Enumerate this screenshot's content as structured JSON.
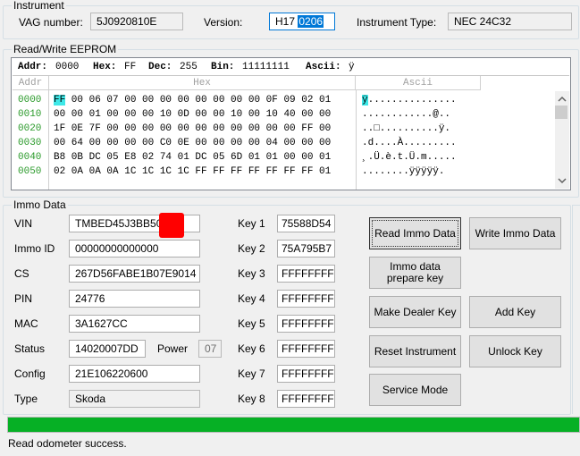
{
  "instrument": {
    "title": "Instrument",
    "vag_label": "VAG number:",
    "vag_value": "5J0920810E",
    "version_label": "Version:",
    "version_prefix": "H17",
    "version_selected": "0206",
    "type_label": "Instrument Type:",
    "type_value": "NEC 24C32"
  },
  "eeprom": {
    "title": "Read/Write EEPROM",
    "status": {
      "addr_label": "Addr:",
      "addr_value": "0000",
      "hex_label": "Hex:",
      "hex_value": "FF",
      "dec_label": "Dec:",
      "dec_value": "255",
      "bin_label": "Bin:",
      "bin_value": "11111111",
      "ascii_label": "Ascii:",
      "ascii_value": "ÿ"
    },
    "col_addr": "Addr",
    "col_hex": "Hex",
    "col_ascii": "Ascii",
    "rows": [
      {
        "addr": "0000",
        "hex_first": "FF",
        "hex_rest": " 00 06 07 00 00 00 00 00 00 00 00 0F 09 02 01",
        "ascii_first": "ÿ",
        "ascii_rest": "..............."
      },
      {
        "addr": "0010",
        "hex_first": "",
        "hex_rest": "00 00 01 00 00 00 10 0D 00 00 10 00 10 40 00 00",
        "ascii_first": "",
        "ascii_rest": "............@.."
      },
      {
        "addr": "0020",
        "hex_first": "",
        "hex_rest": "1F 0E 7F 00 00 00 00 00 00 00 00 00 00 00 FF 00",
        "ascii_first": "",
        "ascii_rest": "..□..........ÿ."
      },
      {
        "addr": "0030",
        "hex_first": "",
        "hex_rest": "00 64 00 00 00 00 C0 0E 00 00 00 00 04 00 00 00",
        "ascii_first": "",
        "ascii_rest": ".d....À........."
      },
      {
        "addr": "0040",
        "hex_first": "",
        "hex_rest": "B8 0B DC 05 E8 02 74 01 DC 05 6D 01 01 00 00 01",
        "ascii_first": "",
        "ascii_rest": "¸.Ü.è.t.Ü.m....."
      },
      {
        "addr": "0050",
        "hex_first": "",
        "hex_rest": "02 0A 0A 0A 1C 1C 1C 1C FF FF FF FF FF FF FF 01",
        "ascii_first": "",
        "ascii_rest": "........ÿÿÿÿÿ."
      }
    ]
  },
  "immo": {
    "title": "Immo Data",
    "vin_label": "VIN",
    "vin_value": "TMBED45J3BB50",
    "immo_id_label": "Immo ID",
    "immo_id_value": "00000000000000",
    "cs_label": "CS",
    "cs_value": "267D56FABE1B07E9014",
    "pin_label": "PIN",
    "pin_value": "24776",
    "mac_label": "MAC",
    "mac_value": "3A1627CC",
    "status_label": "Status",
    "status_value": "14020007DD",
    "power_label": "Power",
    "power_value": "07",
    "config_label": "Config",
    "config_value": "21E106220600",
    "type_label": "Type",
    "type_value": "Skoda",
    "keys": [
      {
        "label": "Key 1",
        "value": "75588D54"
      },
      {
        "label": "Key 2",
        "value": "75A795B7"
      },
      {
        "label": "Key 3",
        "value": "FFFFFFFF"
      },
      {
        "label": "Key 4",
        "value": "FFFFFFFF"
      },
      {
        "label": "Key 5",
        "value": "FFFFFFFF"
      },
      {
        "label": "Key 6",
        "value": "FFFFFFFF"
      },
      {
        "label": "Key 7",
        "value": "FFFFFFFF"
      },
      {
        "label": "Key 8",
        "value": "FFFFFFFF"
      }
    ]
  },
  "buttons": {
    "read_immo": "Read Immo Data",
    "write_immo": "Write Immo Data",
    "immo_prepare_1": "Immo data",
    "immo_prepare_2": "prepare key",
    "make_dealer": "Make Dealer Key",
    "add_key": "Add Key",
    "reset_instrument": "Reset Instrument",
    "unlock_key": "Unlock Key",
    "service_mode": "Service Mode"
  },
  "progress": {
    "fraction": 1.0,
    "color": "#06b025"
  },
  "status_text": "Read odometer success.",
  "colors": {
    "accent": "#0078d7",
    "hex_highlight": "#3ee8e8",
    "addr_green": "#2a9a2a",
    "redact": "#ff0000"
  }
}
